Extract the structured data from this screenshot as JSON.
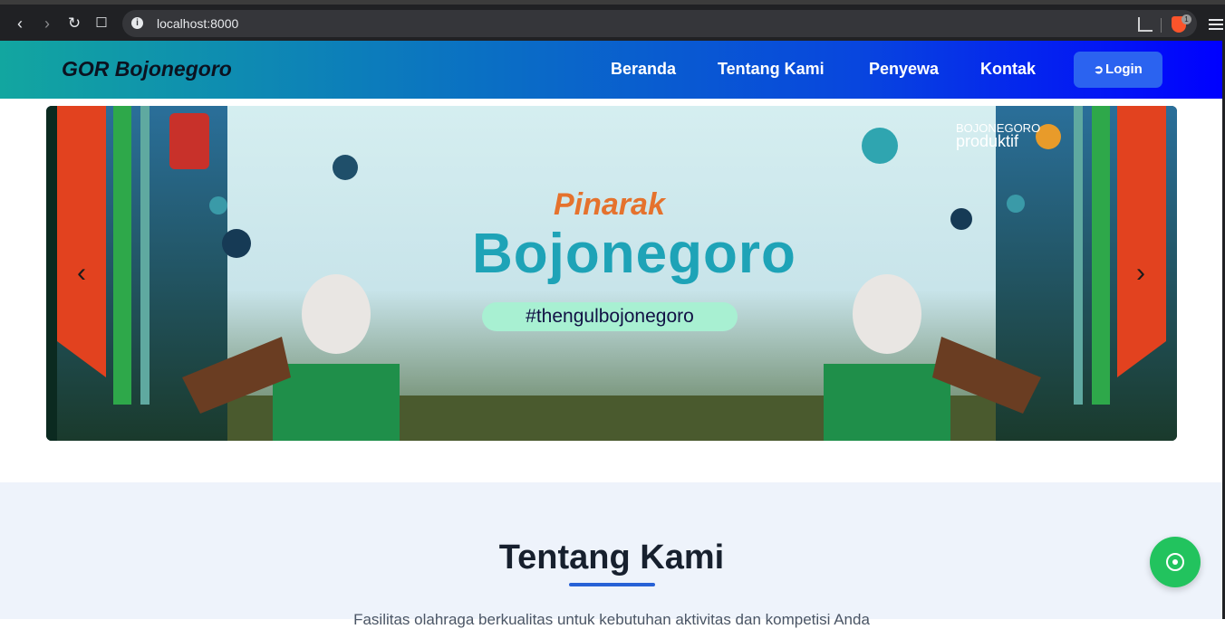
{
  "browser": {
    "url": "localhost:8000",
    "extension_badge": "1"
  },
  "navbar": {
    "brand": "GOR Bojonegoro",
    "links": [
      "Beranda",
      "Tentang Kami",
      "Penyewa",
      "Kontak"
    ],
    "login_label": "Login"
  },
  "hero": {
    "title_small": "Pinarak",
    "title_main": "Bojonegoro",
    "hashtag": "#thengulbojonegoro",
    "logo_top": "BOJONEGORO",
    "logo_bottom": "produktif"
  },
  "about": {
    "title": "Tentang Kami",
    "description": "Fasilitas olahraga berkualitas untuk kebutuhan aktivitas dan kompetisi Anda"
  },
  "colors": {
    "nav_start": "#12a6a0",
    "nav_end": "#0000ff",
    "accent": "#2761d6",
    "whatsapp": "#22c35e"
  }
}
